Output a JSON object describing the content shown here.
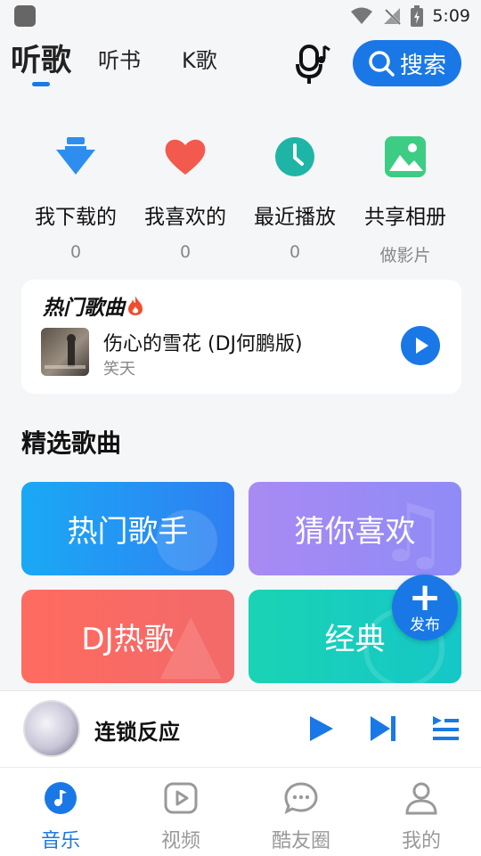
{
  "status_bar": {
    "time": "5:09"
  },
  "top_tabs": [
    {
      "label": "听歌",
      "active": true
    },
    {
      "label": "听书",
      "active": false
    },
    {
      "label": "K歌",
      "active": false
    }
  ],
  "search": {
    "label": "搜索"
  },
  "quick_actions": [
    {
      "label": "我下载的",
      "count": "0",
      "icon": "download-icon",
      "color": "#2e8ef0"
    },
    {
      "label": "我喜欢的",
      "count": "0",
      "icon": "heart-icon",
      "color": "#f25a4e"
    },
    {
      "label": "最近播放",
      "count": "0",
      "icon": "clock-icon",
      "color": "#1fb5a6"
    },
    {
      "label": "共享相册",
      "count": "做影片",
      "icon": "photo-icon",
      "color": "#3dcc84"
    }
  ],
  "hot_songs": {
    "title": "热门歌曲",
    "song_name": "伤心的雪花 (DJ何鹏版)",
    "artist": "笑天"
  },
  "featured": {
    "title": "精选歌曲",
    "tiles": [
      {
        "label": "热门歌手",
        "color_from": "#1aa9f5",
        "color_to": "#2f7ff2"
      },
      {
        "label": "猜你喜欢",
        "color_from": "#a98af3",
        "color_to": "#8f8bf6"
      },
      {
        "label": "DJ热歌",
        "color_from": "#ff6b5f",
        "color_to": "#f26a6a"
      },
      {
        "label": "经典",
        "color_from": "#1ad3b4",
        "color_to": "#15c7c7"
      }
    ]
  },
  "fab": {
    "label": "发布"
  },
  "mini_player": {
    "title": "连锁反应"
  },
  "bottom_nav": [
    {
      "label": "音乐",
      "active": true,
      "icon": "music-note-icon"
    },
    {
      "label": "视频",
      "active": false,
      "icon": "video-play-icon"
    },
    {
      "label": "酷友圈",
      "active": false,
      "icon": "chat-bubble-icon"
    },
    {
      "label": "我的",
      "active": false,
      "icon": "user-icon"
    }
  ],
  "colors": {
    "accent": "#1a78e6",
    "muted": "#999999",
    "background": "#f5f6f8"
  }
}
